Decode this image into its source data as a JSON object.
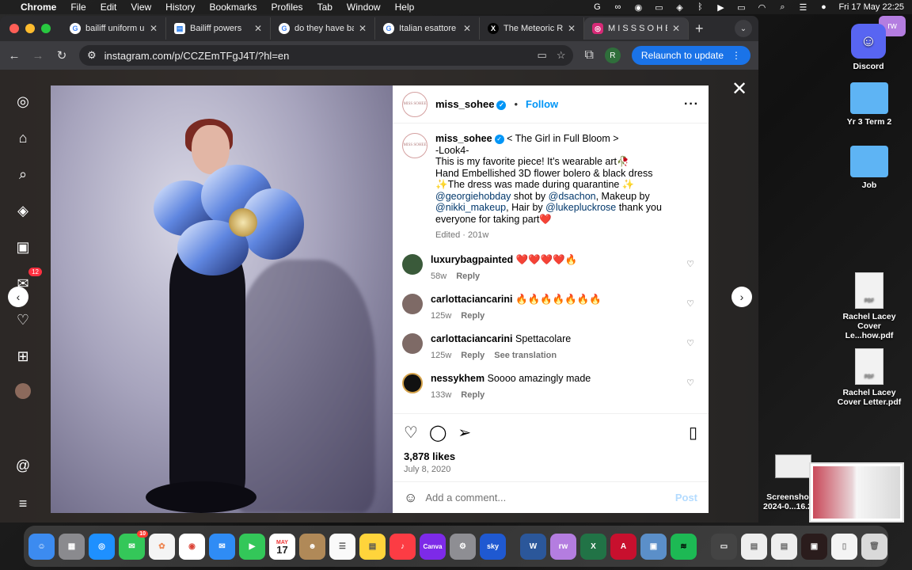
{
  "menubar": {
    "apple": "",
    "app_name": "Chrome",
    "items": [
      "File",
      "Edit",
      "View",
      "History",
      "Bookmarks",
      "Profiles",
      "Tab",
      "Window",
      "Help"
    ],
    "clock": "Fri 17 May  22:25"
  },
  "tabs": [
    {
      "title": "bailiff uniform uk",
      "favicon": "G"
    },
    {
      "title": "Bailiff powers",
      "favicon": "▤"
    },
    {
      "title": "do they have bailiffs",
      "favicon": "G"
    },
    {
      "title": "Italian esattore -",
      "favicon": "G"
    },
    {
      "title": "The Meteoric Rise",
      "favicon": "X"
    },
    {
      "title": "M I S S S O H E E",
      "favicon": "◎"
    }
  ],
  "toolbar": {
    "url": "instagram.com/p/CCZEmTFgJ4T/?hl=en",
    "profile_initial": "R",
    "relaunch_label": "Relaunch to update"
  },
  "sidebar": {
    "notification_count": "12"
  },
  "post": {
    "avatar_text": "MISS SOHEE",
    "username": "miss_sohee",
    "follow_label": "Follow",
    "caption_lines": [
      "< The Girl in Full Bloom >",
      "-Look4-",
      "This is my favorite piece! It’s wearable art🥀",
      "Hand Embellished 3D flower bolero & black dress",
      "✨The dress was made during quarantine ✨"
    ],
    "credits": {
      "tag1": "@georgiehobday",
      "shot_by": " shot by ",
      "tag2": "@dsachon",
      "makeup_by": ", Makeup by ",
      "tag3": "@nikki_makeup",
      "hair_by": ", Hair by ",
      "tag4": "@lukepluckrose",
      "thanks": " thank you everyone for taking part❤️"
    },
    "caption_meta": "Edited · 201w",
    "comments": [
      {
        "user": "luxurybagpainted",
        "text": "❤️❤️❤️❤️🔥",
        "age": "58w",
        "reply": "Reply",
        "extra": ""
      },
      {
        "user": "carlottaciancarini",
        "text": "🔥🔥🔥🔥🔥🔥🔥",
        "age": "125w",
        "reply": "Reply",
        "extra": ""
      },
      {
        "user": "carlottaciancarini",
        "text": "Spettacolare",
        "age": "125w",
        "reply": "Reply",
        "extra": "See translation"
      },
      {
        "user": "nessykhem",
        "text": "Soooo amazingly made",
        "age": "133w",
        "reply": "Reply",
        "extra": ""
      }
    ],
    "likes": "3,878 likes",
    "date": "July 8, 2020",
    "add_comment_placeholder": "Add a comment...",
    "post_label": "Post"
  },
  "desktop": {
    "discord_label": "Discord",
    "folder1": "Yr 3 Term 2",
    "folder2": "Job",
    "pdf1": "Rachel Lacey Cover Le...how.pdf",
    "pdf2": "Rachel Lacey Cover Letter.pdf",
    "pdf_tag": "PDF",
    "screenshot_label": "Screensho 2024-0...16.2",
    "rw_badge": "rw"
  },
  "dock": {
    "messages_badge": "10",
    "calendar_month": "MAY",
    "calendar_day": "17",
    "canva_label": "Canva",
    "sky_label": "sky",
    "rw_label": "rw"
  }
}
